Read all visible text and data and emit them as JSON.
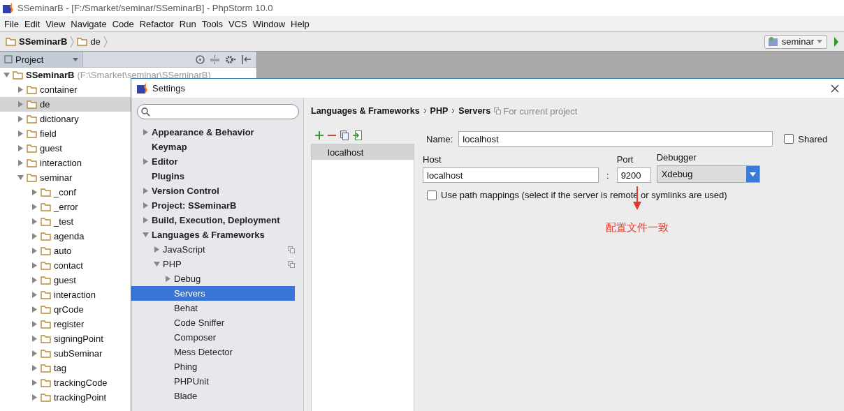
{
  "window": {
    "title": "SSeminarB - [F:/Smarket/seminar/SSeminarB] - PhpStorm 10.0"
  },
  "menu": [
    "File",
    "Edit",
    "View",
    "Navigate",
    "Code",
    "Refactor",
    "Run",
    "Tools",
    "VCS",
    "Window",
    "Help"
  ],
  "breadcrumb": [
    "SSeminarB",
    "de"
  ],
  "run_config": {
    "label": "seminar"
  },
  "project_panel": {
    "title": "Project",
    "tree": [
      {
        "label": "SSeminarB",
        "path": "(F:\\Smarket\\seminar\\SSeminarB)",
        "expanded": true,
        "selected": false,
        "children": [
          {
            "label": "container",
            "expanded": false,
            "selected": false
          },
          {
            "label": "de",
            "expanded": false,
            "selected": true
          },
          {
            "label": "dictionary",
            "expanded": false,
            "selected": false
          },
          {
            "label": "field",
            "expanded": false,
            "selected": false
          },
          {
            "label": "guest",
            "expanded": false,
            "selected": false
          },
          {
            "label": "interaction",
            "expanded": false,
            "selected": false
          },
          {
            "label": "seminar",
            "expanded": true,
            "selected": false,
            "children": [
              {
                "label": "_conf",
                "expanded": false,
                "selected": false
              },
              {
                "label": "_error",
                "expanded": false,
                "selected": false
              },
              {
                "label": "_test",
                "expanded": false,
                "selected": false
              },
              {
                "label": "agenda",
                "expanded": false,
                "selected": false
              },
              {
                "label": "auto",
                "expanded": false,
                "selected": false
              },
              {
                "label": "contact",
                "expanded": false,
                "selected": false
              },
              {
                "label": "guest",
                "expanded": false,
                "selected": false
              },
              {
                "label": "interaction",
                "expanded": false,
                "selected": false
              },
              {
                "label": "qrCode",
                "expanded": false,
                "selected": false
              },
              {
                "label": "register",
                "expanded": false,
                "selected": false
              },
              {
                "label": "signingPoint",
                "expanded": false,
                "selected": false
              },
              {
                "label": "subSeminar",
                "expanded": false,
                "selected": false
              },
              {
                "label": "tag",
                "expanded": false,
                "selected": false
              },
              {
                "label": "trackingCode",
                "expanded": false,
                "selected": false
              },
              {
                "label": "trackingPoint",
                "expanded": false,
                "selected": false
              }
            ]
          }
        ]
      }
    ]
  },
  "settings": {
    "title": "Settings",
    "tree": [
      {
        "label": "Appearance & Behavior",
        "kind": "group",
        "expanded": false,
        "selected": false
      },
      {
        "label": "Keymap",
        "kind": "leaf",
        "selected": false
      },
      {
        "label": "Editor",
        "kind": "group",
        "expanded": false,
        "selected": false
      },
      {
        "label": "Plugins",
        "kind": "leaf",
        "selected": false
      },
      {
        "label": "Version Control",
        "kind": "group",
        "expanded": false,
        "selected": false
      },
      {
        "label": "Project: SSeminarB",
        "kind": "group",
        "expanded": false,
        "selected": false
      },
      {
        "label": "Build, Execution, Deployment",
        "kind": "group",
        "expanded": false,
        "selected": false
      },
      {
        "label": "Languages & Frameworks",
        "kind": "group",
        "expanded": true,
        "selected": false,
        "children": [
          {
            "label": "JavaScript",
            "kind": "group",
            "expanded": false,
            "selected": false,
            "project_scope": true
          },
          {
            "label": "PHP",
            "kind": "group",
            "expanded": true,
            "selected": false,
            "project_scope": true,
            "children": [
              {
                "label": "Debug",
                "kind": "group",
                "expanded": false,
                "selected": false
              },
              {
                "label": "Servers",
                "kind": "leaf",
                "selected": true
              },
              {
                "label": "Behat",
                "kind": "leaf",
                "selected": false
              },
              {
                "label": "Code Sniffer",
                "kind": "leaf",
                "selected": false
              },
              {
                "label": "Composer",
                "kind": "leaf",
                "selected": false
              },
              {
                "label": "Mess Detector",
                "kind": "leaf",
                "selected": false
              },
              {
                "label": "Phing",
                "kind": "leaf",
                "selected": false
              },
              {
                "label": "PHPUnit",
                "kind": "leaf",
                "selected": false
              },
              {
                "label": "Blade",
                "kind": "leaf",
                "selected": false
              }
            ]
          }
        ]
      }
    ],
    "path": [
      "Languages & Frameworks",
      "PHP",
      "Servers"
    ],
    "scope_note": "For current project",
    "servers": [
      {
        "label": "localhost",
        "selected": true
      }
    ],
    "form": {
      "name_label": "Name:",
      "name": "localhost",
      "shared": {
        "label": "Shared",
        "checked": false
      },
      "host_label": "Host",
      "host": "localhost",
      "colon": ":",
      "port_label": "Port",
      "port": "9200",
      "debugger_label": "Debugger",
      "debugger": "Xdebug",
      "path_mappings": {
        "label": "Use path mappings (select if the server is remote or symlinks are used)",
        "checked": false
      }
    }
  },
  "annotation": {
    "text": "配置文件一致"
  }
}
